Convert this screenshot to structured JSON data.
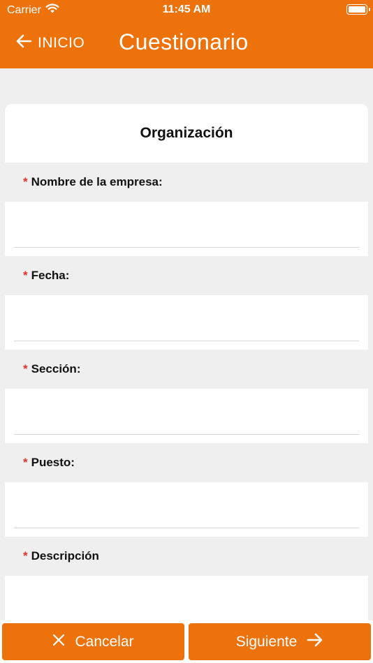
{
  "status_bar": {
    "carrier": "Carrier",
    "time": "11:45 AM"
  },
  "nav": {
    "back_label": "INICIO",
    "title": "Cuestionario"
  },
  "form": {
    "section_title": "Organización",
    "required_marker": "*",
    "fields": [
      {
        "label": "Nombre de la empresa:",
        "value": ""
      },
      {
        "label": "Fecha:",
        "value": ""
      },
      {
        "label": "Sección:",
        "value": ""
      },
      {
        "label": "Puesto:",
        "value": ""
      },
      {
        "label": "Descripción",
        "value": ""
      }
    ]
  },
  "actions": {
    "cancel_label": "Cancelar",
    "next_label": "Siguiente"
  },
  "colors": {
    "accent": "#ee720c",
    "required": "#e2342a",
    "background": "#efefef"
  },
  "icons": {
    "wifi": "wifi-icon",
    "battery": "battery-icon",
    "back": "arrow-left-icon",
    "cancel": "close-icon",
    "next": "arrow-right-icon"
  }
}
